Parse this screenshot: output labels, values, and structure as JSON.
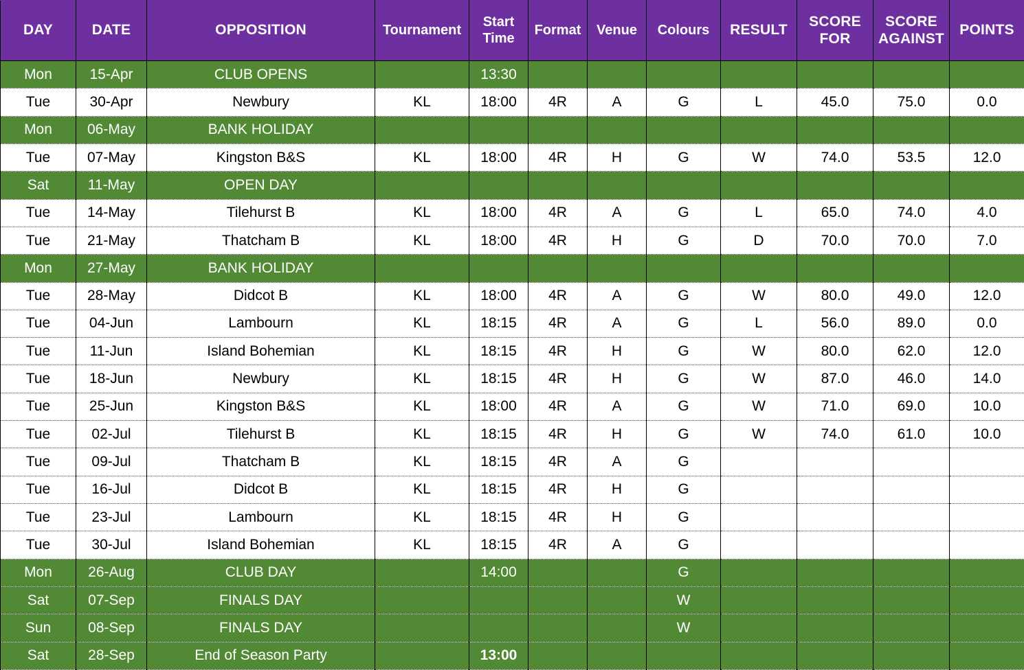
{
  "table": {
    "headers": [
      {
        "key": "day",
        "label": "DAY",
        "style": "caps"
      },
      {
        "key": "date",
        "label": "DATE",
        "style": "caps"
      },
      {
        "key": "opposition",
        "label": "OPPOSITION",
        "style": "caps"
      },
      {
        "key": "tournament",
        "label": "Tournament",
        "style": "mixed"
      },
      {
        "key": "start_time",
        "label": "Start\nTime",
        "style": "mixed"
      },
      {
        "key": "format",
        "label": "Format",
        "style": "mixed"
      },
      {
        "key": "venue",
        "label": "Venue",
        "style": "mixed"
      },
      {
        "key": "colours",
        "label": "Colours",
        "style": "mixed"
      },
      {
        "key": "result",
        "label": "RESULT",
        "style": "caps"
      },
      {
        "key": "score_for",
        "label": "SCORE\nFOR",
        "style": "caps"
      },
      {
        "key": "score_against",
        "label": "SCORE\nAGAINST",
        "style": "caps"
      },
      {
        "key": "points",
        "label": "POINTS",
        "style": "caps"
      }
    ],
    "colors": {
      "header_bg": "#6E2FA0",
      "event_row_bg": "#528935",
      "match_row_bg": "#FFFFFF",
      "header_text": "#FFFFFF",
      "event_row_text": "#FFFFFF",
      "match_row_text": "#000000",
      "vertical_border": "#000000",
      "horizontal_border": "#444444"
    },
    "rows": [
      {
        "type": "event",
        "day": "Mon",
        "date": "15-Apr",
        "opposition": "CLUB OPENS",
        "tournament": "",
        "start_time": "13:30",
        "format": "",
        "venue": "",
        "colours": "",
        "result": "",
        "score_for": "",
        "score_against": "",
        "points": ""
      },
      {
        "type": "match",
        "day": "Tue",
        "date": "30-Apr",
        "opposition": "Newbury",
        "tournament": "KL",
        "start_time": "18:00",
        "format": "4R",
        "venue": "A",
        "colours": "G",
        "result": "L",
        "score_for": "45.0",
        "score_against": "75.0",
        "points": "0.0"
      },
      {
        "type": "event",
        "day": "Mon",
        "date": "06-May",
        "opposition": "BANK HOLIDAY",
        "tournament": "",
        "start_time": "",
        "format": "",
        "venue": "",
        "colours": "",
        "result": "",
        "score_for": "",
        "score_against": "",
        "points": ""
      },
      {
        "type": "match",
        "day": "Tue",
        "date": "07-May",
        "opposition": "Kingston B&S",
        "tournament": "KL",
        "start_time": "18:00",
        "format": "4R",
        "venue": "H",
        "colours": "G",
        "result": "W",
        "score_for": "74.0",
        "score_against": "53.5",
        "points": "12.0"
      },
      {
        "type": "event",
        "day": "Sat",
        "date": "11-May",
        "opposition": "OPEN DAY",
        "tournament": "",
        "start_time": "",
        "format": "",
        "venue": "",
        "colours": "",
        "result": "",
        "score_for": "",
        "score_against": "",
        "points": ""
      },
      {
        "type": "match",
        "day": "Tue",
        "date": "14-May",
        "opposition": "Tilehurst B",
        "tournament": "KL",
        "start_time": "18:00",
        "format": "4R",
        "venue": "A",
        "colours": "G",
        "result": "L",
        "score_for": "65.0",
        "score_against": "74.0",
        "points": "4.0"
      },
      {
        "type": "match",
        "day": "Tue",
        "date": "21-May",
        "opposition": "Thatcham B",
        "tournament": "KL",
        "start_time": "18:00",
        "format": "4R",
        "venue": "H",
        "colours": "G",
        "result": "D",
        "score_for": "70.0",
        "score_against": "70.0",
        "points": "7.0"
      },
      {
        "type": "event",
        "day": "Mon",
        "date": "27-May",
        "opposition": "BANK HOLIDAY",
        "tournament": "",
        "start_time": "",
        "format": "",
        "venue": "",
        "colours": "",
        "result": "",
        "score_for": "",
        "score_against": "",
        "points": ""
      },
      {
        "type": "match",
        "day": "Tue",
        "date": "28-May",
        "opposition": "Didcot B",
        "tournament": "KL",
        "start_time": "18:00",
        "format": "4R",
        "venue": "A",
        "colours": "G",
        "result": "W",
        "score_for": "80.0",
        "score_against": "49.0",
        "points": "12.0"
      },
      {
        "type": "match",
        "day": "Tue",
        "date": "04-Jun",
        "opposition": "Lambourn",
        "tournament": "KL",
        "start_time": "18:15",
        "format": "4R",
        "venue": "A",
        "colours": "G",
        "result": "L",
        "score_for": "56.0",
        "score_against": "89.0",
        "points": "0.0"
      },
      {
        "type": "match",
        "day": "Tue",
        "date": "11-Jun",
        "opposition": "Island Bohemian",
        "tournament": "KL",
        "start_time": "18:15",
        "format": "4R",
        "venue": "H",
        "colours": "G",
        "result": "W",
        "score_for": "80.0",
        "score_against": "62.0",
        "points": "12.0"
      },
      {
        "type": "match",
        "day": "Tue",
        "date": "18-Jun",
        "opposition": "Newbury",
        "tournament": "KL",
        "start_time": "18:15",
        "format": "4R",
        "venue": "H",
        "colours": "G",
        "result": "W",
        "score_for": "87.0",
        "score_against": "46.0",
        "points": "14.0"
      },
      {
        "type": "match",
        "day": "Tue",
        "date": "25-Jun",
        "opposition": "Kingston B&S",
        "tournament": "KL",
        "start_time": "18:00",
        "format": "4R",
        "venue": "A",
        "colours": "G",
        "result": "W",
        "score_for": "71.0",
        "score_against": "69.0",
        "points": "10.0"
      },
      {
        "type": "match",
        "day": "Tue",
        "date": "02-Jul",
        "opposition": "Tilehurst B",
        "tournament": "KL",
        "start_time": "18:15",
        "format": "4R",
        "venue": "H",
        "colours": "G",
        "result": "W",
        "score_for": "74.0",
        "score_against": "61.0",
        "points": "10.0"
      },
      {
        "type": "match",
        "day": "Tue",
        "date": "09-Jul",
        "opposition": "Thatcham B",
        "tournament": "KL",
        "start_time": "18:15",
        "format": "4R",
        "venue": "A",
        "colours": "G",
        "result": "",
        "score_for": "",
        "score_against": "",
        "points": ""
      },
      {
        "type": "match",
        "day": "Tue",
        "date": "16-Jul",
        "opposition": "Didcot B",
        "tournament": "KL",
        "start_time": "18:15",
        "format": "4R",
        "venue": "H",
        "colours": "G",
        "result": "",
        "score_for": "",
        "score_against": "",
        "points": ""
      },
      {
        "type": "match",
        "day": "Tue",
        "date": "23-Jul",
        "opposition": "Lambourn",
        "tournament": "KL",
        "start_time": "18:15",
        "format": "4R",
        "venue": "H",
        "colours": "G",
        "result": "",
        "score_for": "",
        "score_against": "",
        "points": ""
      },
      {
        "type": "match",
        "day": "Tue",
        "date": "30-Jul",
        "opposition": "Island Bohemian",
        "tournament": "KL",
        "start_time": "18:15",
        "format": "4R",
        "venue": "A",
        "colours": "G",
        "result": "",
        "score_for": "",
        "score_against": "",
        "points": ""
      },
      {
        "type": "event",
        "day": "Mon",
        "date": "26-Aug",
        "opposition": "CLUB DAY",
        "tournament": "",
        "start_time": "14:00",
        "format": "",
        "venue": "",
        "colours": "G",
        "result": "",
        "score_for": "",
        "score_against": "",
        "points": ""
      },
      {
        "type": "event",
        "day": "Sat",
        "date": "07-Sep",
        "opposition": "FINALS DAY",
        "tournament": "",
        "start_time": "",
        "format": "",
        "venue": "",
        "colours": "W",
        "result": "",
        "score_for": "",
        "score_against": "",
        "points": ""
      },
      {
        "type": "event",
        "day": "Sun",
        "date": "08-Sep",
        "opposition": "FINALS DAY",
        "tournament": "",
        "start_time": "",
        "format": "",
        "venue": "",
        "colours": "W",
        "result": "",
        "score_for": "",
        "score_against": "",
        "points": ""
      },
      {
        "type": "event",
        "day": "Sat",
        "date": "28-Sep",
        "opposition": "End of Season Party",
        "tournament": "",
        "start_time": "13:00",
        "start_time_bold": true,
        "format": "",
        "venue": "",
        "colours": "",
        "result": "",
        "score_for": "",
        "score_against": "",
        "points": ""
      }
    ]
  }
}
